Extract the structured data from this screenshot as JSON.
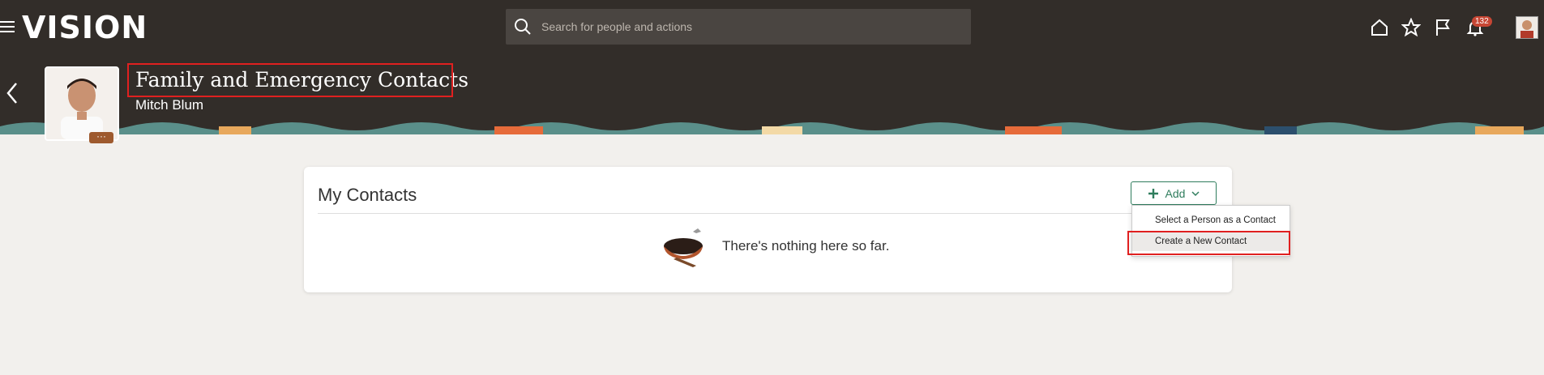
{
  "app": {
    "logo": "VISION"
  },
  "search": {
    "placeholder": "Search for people and actions"
  },
  "notifications": {
    "count": "132"
  },
  "header": {
    "title": "Family and Emergency Contacts",
    "person": "Mitch Blum"
  },
  "card": {
    "title": "My Contacts",
    "add_label": "Add",
    "empty_text": "There's nothing here so far."
  },
  "menu": {
    "items": [
      "Select a Person as a Contact",
      "Create a New Contact"
    ]
  },
  "icons": [
    "menu-icon",
    "search-icon",
    "home-icon",
    "star-icon",
    "flag-icon",
    "bell-icon",
    "back-icon",
    "plus-icon",
    "chevron-down-icon",
    "nest-icon"
  ],
  "colors": {
    "header_bg": "#322d29",
    "accent": "#2f7d5d",
    "highlight": "#e02020"
  }
}
